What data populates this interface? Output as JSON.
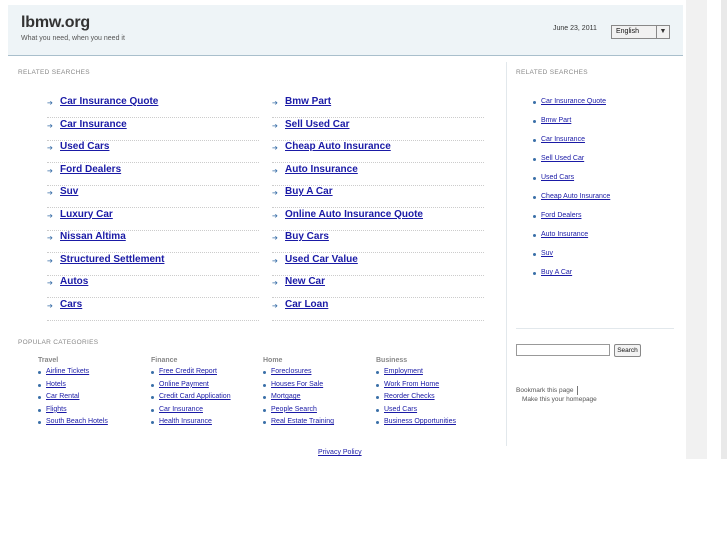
{
  "header": {
    "site_title": "lbmw.org",
    "tagline": "What you need, when you need it",
    "date": "June 23, 2011",
    "language_selected": "English"
  },
  "related_label_main": "RELATED SEARCHES",
  "related_label_side": "RELATED SEARCHES",
  "main_links_left": [
    "Car Insurance Quote",
    "Car Insurance",
    "Used Cars",
    "Ford Dealers",
    "Suv",
    "Luxury Car",
    "Nissan Altima",
    "Structured Settlement",
    "Autos",
    "Cars"
  ],
  "main_links_right": [
    "Bmw Part",
    "Sell Used Car",
    "Cheap Auto Insurance",
    "Auto Insurance",
    "Buy A Car",
    "Online Auto Insurance Quote",
    "Buy Cars",
    "Used Car Value",
    "New Car",
    "Car Loan"
  ],
  "side_links": [
    "Car Insurance Quote",
    "Bmw Part",
    "Car Insurance",
    "Sell Used Car",
    "Used Cars",
    "Cheap Auto Insurance",
    "Ford Dealers",
    "Auto Insurance",
    "Suv",
    "Buy A Car"
  ],
  "popular_label": "POPULAR CATEGORIES",
  "categories": [
    {
      "title": "Travel",
      "items": [
        "Airline Tickets",
        "Hotels",
        "Car Rental",
        "Flights",
        "South Beach Hotels"
      ]
    },
    {
      "title": "Finance",
      "items": [
        "Free Credit Report",
        "Online Payment",
        "Credit Card Application",
        "Car Insurance",
        "Health Insurance"
      ]
    },
    {
      "title": "Home",
      "items": [
        "Foreclosures",
        "Houses For Sale",
        "Mortgage",
        "People Search",
        "Real Estate Training"
      ]
    },
    {
      "title": "Business",
      "items": [
        "Employment",
        "Work From Home",
        "Reorder Checks",
        "Used Cars",
        "Business Opportunities"
      ]
    }
  ],
  "search": {
    "button_label": "Search",
    "value": ""
  },
  "bookmark_text": "Bookmark this page",
  "homepage_text": "Make this your homepage",
  "privacy_text": "Privacy Policy",
  "icons": {
    "link_arrow": "arrow-icon",
    "dropdown": "chevron-down-icon"
  },
  "colors": {
    "link": "#1a1aa6",
    "header_bg": "#eef4f7",
    "accent": "#3a6fa8"
  }
}
